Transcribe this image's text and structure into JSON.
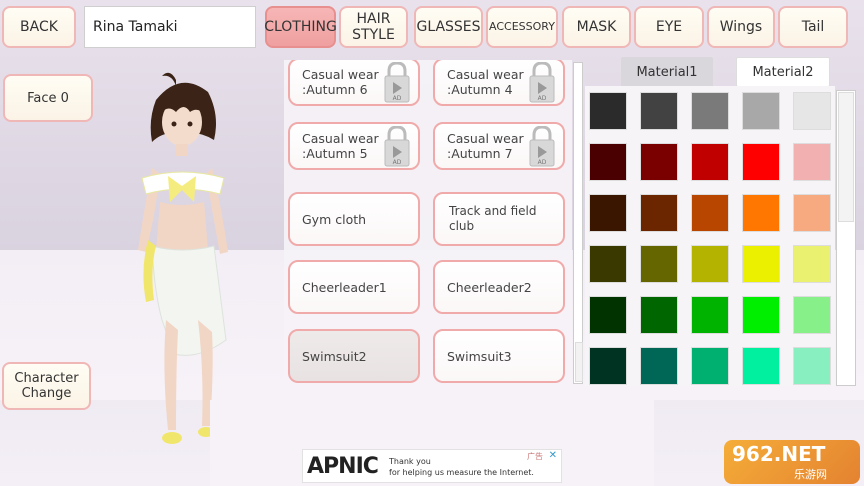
{
  "header": {
    "back_label": "BACK",
    "character_name": "Rina Tamaki",
    "tabs": [
      {
        "label": "CLOTHING",
        "active": true
      },
      {
        "label": "HAIR\nSTYLE",
        "active": false
      },
      {
        "label": "GLASSES",
        "active": false
      },
      {
        "label": "ACCESSORY",
        "active": false
      },
      {
        "label": "MASK",
        "active": false
      },
      {
        "label": "EYE",
        "active": false
      },
      {
        "label": "Wings",
        "active": false
      },
      {
        "label": "Tail",
        "active": false
      }
    ]
  },
  "left": {
    "face_label": "Face",
    "face_value": "0",
    "character_change_label": "Character\nChange"
  },
  "items": [
    {
      "label": "Casual wear\n:Autumn 6",
      "locked": true
    },
    {
      "label": "Casual wear\n:Autumn 4",
      "locked": true
    },
    {
      "label": "Casual wear\n:Autumn 5",
      "locked": true
    },
    {
      "label": "Casual wear\n:Autumn 7",
      "locked": true
    },
    {
      "label": "Gym cloth",
      "locked": false
    },
    {
      "label": "Track and field club",
      "locked": false
    },
    {
      "label": "Cheerleader1",
      "locked": false
    },
    {
      "label": "Cheerleader2",
      "locked": false
    },
    {
      "label": "Swimsuit2",
      "locked": false,
      "selected": true
    },
    {
      "label": "Swimsuit3",
      "locked": false
    }
  ],
  "lock_badge": "AD",
  "materials": {
    "tab1": "Material1",
    "tab2": "Material2",
    "active": "Material2"
  },
  "colors": [
    [
      "#2b2b2b",
      "#424242",
      "#7a7a7a",
      "#a8a8a8",
      "#e6e6e6"
    ],
    [
      "#4a0000",
      "#7a0000",
      "#c00000",
      "#ff0000",
      "#f2b0b0"
    ],
    [
      "#3a1500",
      "#6b2600",
      "#b84600",
      "#ff7700",
      "#f7aa80"
    ],
    [
      "#3a3a00",
      "#666600",
      "#b3b300",
      "#eaf000",
      "#eaf070"
    ],
    [
      "#003300",
      "#006600",
      "#00b300",
      "#00ee00",
      "#88f088"
    ],
    [
      "#003322",
      "#006655",
      "#00b070",
      "#00f0a0",
      "#88f0c0"
    ]
  ],
  "ad": {
    "logo": "APNIC",
    "text": "Thank you\nfor helping us measure the Internet.",
    "tag": "广告",
    "close": "✕"
  },
  "watermark": {
    "main": "962.NET",
    "sub": "乐游网"
  }
}
